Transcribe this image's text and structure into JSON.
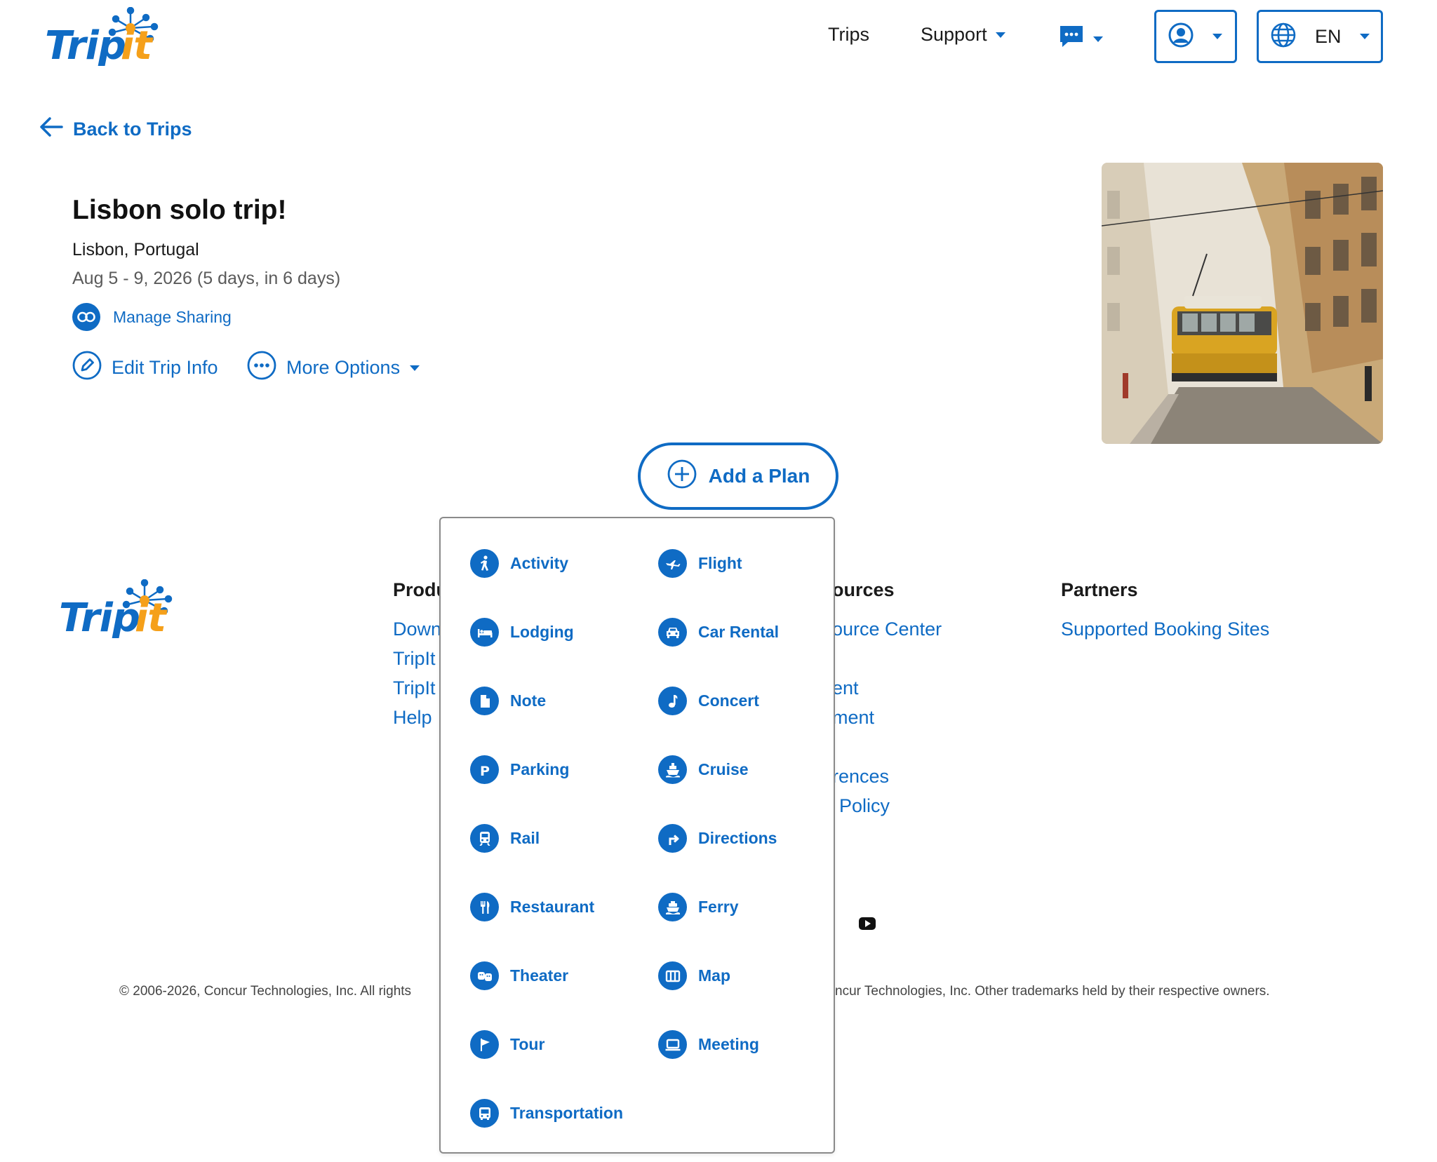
{
  "brand": {
    "logo_text": "TripIt",
    "accent": "#0f6bc4",
    "logo_orange": "#f5a01a"
  },
  "header": {
    "nav": {
      "trips": "Trips",
      "support": "Support"
    },
    "messages_icon": "chat-bubble-icon",
    "account_icon": "user-circle-icon",
    "language": {
      "icon": "globe-icon",
      "code": "EN"
    }
  },
  "back_link": "Back to Trips",
  "trip": {
    "title": "Lisbon solo trip!",
    "location": "Lisbon, Portugal",
    "dates": "Aug 5 - 9, 2026 (5 days, in 6 days)",
    "manage_sharing": "Manage Sharing",
    "edit_info": "Edit Trip Info",
    "more_options": "More Options",
    "photo_alt": "Yellow tram on a narrow Lisbon street"
  },
  "add_plan": "Add a Plan",
  "plan_types": [
    {
      "label": "Activity",
      "icon": "walking-person-icon"
    },
    {
      "label": "Flight",
      "icon": "airplane-icon"
    },
    {
      "label": "Lodging",
      "icon": "bed-icon"
    },
    {
      "label": "Car Rental",
      "icon": "car-icon"
    },
    {
      "label": "Note",
      "icon": "document-icon"
    },
    {
      "label": "Concert",
      "icon": "music-note-icon"
    },
    {
      "label": "Parking",
      "icon": "parking-icon"
    },
    {
      "label": "Cruise",
      "icon": "ship-icon"
    },
    {
      "label": "Rail",
      "icon": "train-icon"
    },
    {
      "label": "Directions",
      "icon": "turn-arrow-icon"
    },
    {
      "label": "Restaurant",
      "icon": "fork-knife-icon"
    },
    {
      "label": "Ferry",
      "icon": "ferry-icon"
    },
    {
      "label": "Theater",
      "icon": "theater-masks-icon"
    },
    {
      "label": "Map",
      "icon": "map-icon"
    },
    {
      "label": "Tour",
      "icon": "flag-icon"
    },
    {
      "label": "Meeting",
      "icon": "laptop-icon"
    },
    {
      "label": "Transportation",
      "icon": "bus-icon"
    }
  ],
  "footer": {
    "products_head": "Produ",
    "products_links": [
      "Down",
      "TripIt",
      "TripIt",
      "Help"
    ],
    "resources_head": "ources",
    "resources_links": [
      "ource Center",
      "ent",
      "ment",
      "rences",
      "Policy"
    ],
    "partners_head": "Partners",
    "partners_links": [
      "Supported Booking Sites"
    ],
    "copyright_left": "© 2006-2026, Concur Technologies, Inc. All rights",
    "copyright_right": "ncur Technologies, Inc. Other trademarks held by their respective owners.",
    "social_icon": "youtube-icon"
  }
}
